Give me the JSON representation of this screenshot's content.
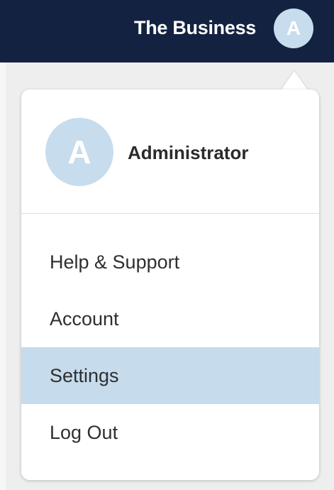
{
  "header": {
    "business_name": "The Business",
    "avatar_initial": "A"
  },
  "dropdown": {
    "profile": {
      "avatar_initial": "A",
      "name": "Administrator"
    },
    "menu_items": [
      {
        "label": "Help & Support",
        "active": false
      },
      {
        "label": "Account",
        "active": false
      },
      {
        "label": "Settings",
        "active": true
      },
      {
        "label": "Log Out",
        "active": false
      }
    ]
  },
  "colors": {
    "topbar": "#132240",
    "avatar": "#c7dced",
    "active_item": "#c6dbeb"
  }
}
